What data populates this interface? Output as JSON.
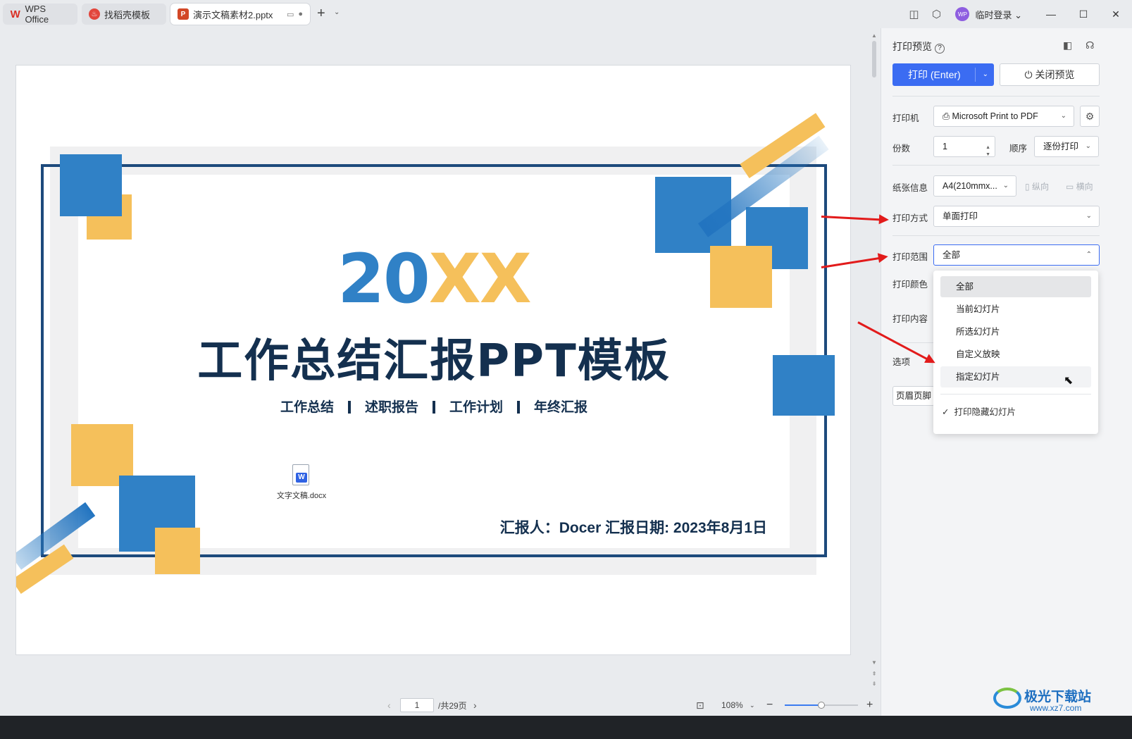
{
  "tabs": [
    {
      "label": "WPS Office",
      "icon": "wps-logo-icon"
    },
    {
      "label": "找稻壳模板",
      "icon": "docer-icon"
    },
    {
      "label": "演示文稿素材2.pptx",
      "icon": "ppt-file-icon"
    }
  ],
  "titlebar": {
    "user_initials": "WP",
    "user_label": "临时登录"
  },
  "slide": {
    "year_a": "20",
    "year_b": "XX",
    "title": "工作总结汇报PPT模板",
    "subtitles": [
      "工作总结",
      "述职报告",
      "工作计划",
      "年终汇报"
    ],
    "reporter": "汇报人：Docer  汇报日期: 2023年8月1日",
    "embedded_file": {
      "name": "文字文稿.docx",
      "badge": "W"
    },
    "colors": {
      "blue": "#3081c6",
      "yellow": "#f5c05b",
      "navy": "#14304f"
    }
  },
  "status": {
    "page_current": "1",
    "page_total": "/共29页",
    "zoom": "108%",
    "zoom_fraction": 0.5
  },
  "panel": {
    "title": "打印预览",
    "help": "?",
    "print_button": "打印 (Enter)",
    "close_button": "关闭预览",
    "printer_label": "打印机",
    "printer_value": "Microsoft Print to PDF",
    "copies_label": "份数",
    "copies_value": "1",
    "order_label": "顺序",
    "order_value": "逐份打印",
    "paper_label": "纸张信息",
    "paper_value": "A4(210mmx...",
    "portrait": "纵向",
    "landscape": "横向",
    "mode_label": "打印方式",
    "mode_value": "单面打印",
    "range_label": "打印范围",
    "range_value": "全部",
    "color_label": "打印颜色",
    "content_label": "打印内容",
    "options_label": "选项",
    "header_footer": "页眉页脚"
  },
  "range_dropdown": {
    "items": [
      "全部",
      "当前幻灯片",
      "所选幻灯片",
      "自定义放映",
      "指定幻灯片"
    ],
    "selected_index": 0,
    "hover_index": 4,
    "checkbox_label": "打印隐藏幻灯片",
    "checkbox_checked": true
  },
  "watermark": {
    "name": "极光下载站",
    "url": "www.xz7.com"
  }
}
